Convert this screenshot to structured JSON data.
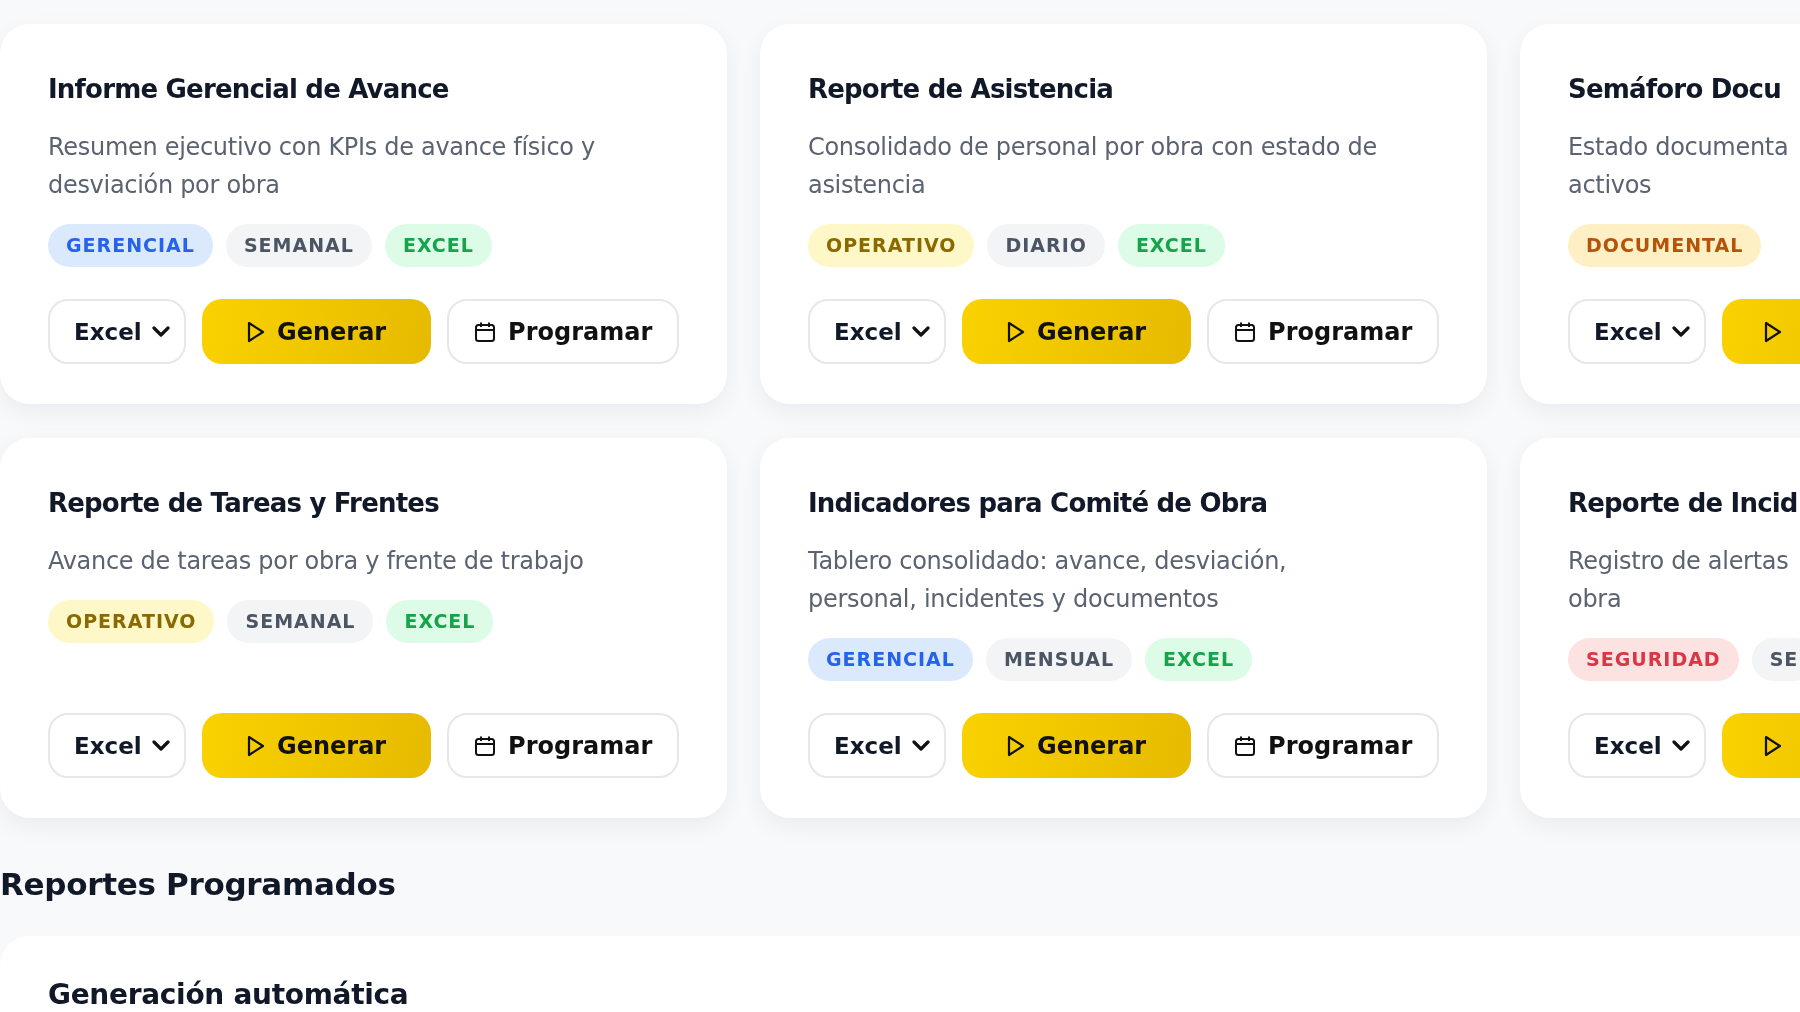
{
  "report_cards": [
    {
      "title": "Informe Gerencial de Avance",
      "description": [
        "Resumen ejecutivo con KPIs de avance físico y",
        "desviación por obra"
      ],
      "tags": [
        {
          "label": "GERENCIAL",
          "kind": "gerencial"
        },
        {
          "label": "SEMANAL",
          "kind": "frequency"
        },
        {
          "label": "EXCEL",
          "kind": "format"
        }
      ],
      "format": "Excel",
      "generate": "Generar",
      "schedule": "Programar"
    },
    {
      "title": "Reporte de Asistencia",
      "description": [
        "Consolidado de personal por obra con estado de",
        "asistencia"
      ],
      "tags": [
        {
          "label": "OPERATIVO",
          "kind": "operativo"
        },
        {
          "label": "DIARIO",
          "kind": "frequency"
        },
        {
          "label": "EXCEL",
          "kind": "format"
        }
      ],
      "format": "Excel",
      "generate": "Generar",
      "schedule": "Programar"
    },
    {
      "title": "Semáforo Docu",
      "description": [
        "Estado documenta",
        "activos"
      ],
      "tags": [
        {
          "label": "DOCUMENTAL",
          "kind": "documental"
        }
      ],
      "format": "Excel"
    },
    {
      "title": "Reporte de Tareas y Frentes",
      "description": [
        "Avance de tareas por obra y frente de trabajo"
      ],
      "tags": [
        {
          "label": "OPERATIVO",
          "kind": "operativo"
        },
        {
          "label": "SEMANAL",
          "kind": "frequency"
        },
        {
          "label": "EXCEL",
          "kind": "format"
        }
      ],
      "format": "Excel",
      "generate": "Generar",
      "schedule": "Programar"
    },
    {
      "title": "Indicadores para Comité de Obra",
      "description": [
        "Tablero consolidado: avance, desviación,",
        "personal, incidentes y documentos"
      ],
      "tags": [
        {
          "label": "GERENCIAL",
          "kind": "gerencial"
        },
        {
          "label": "MENSUAL",
          "kind": "frequency"
        },
        {
          "label": "EXCEL",
          "kind": "format"
        }
      ],
      "format": "Excel",
      "generate": "Generar",
      "schedule": "Programar"
    },
    {
      "title": "Reporte de Incid",
      "description": [
        "Registro de alertas",
        "obra"
      ],
      "tags": [
        {
          "label": "SEGURIDAD",
          "kind": "seguridad"
        },
        {
          "label": "SE",
          "kind": "frequency"
        }
      ],
      "format": "Excel"
    }
  ],
  "scheduled_section": {
    "heading": "Reportes Programados",
    "card_title": "Generación automática"
  }
}
